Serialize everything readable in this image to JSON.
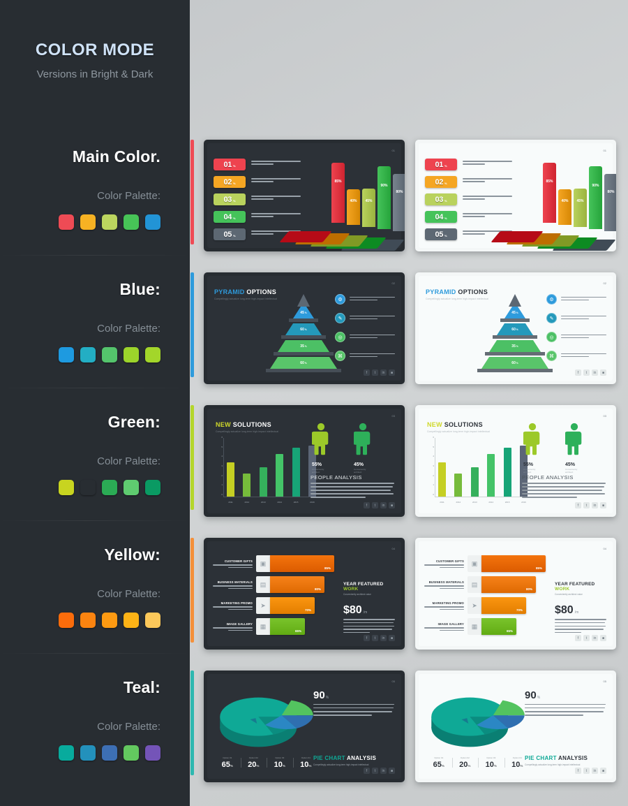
{
  "sidebar": {
    "title": "COLOR MODE",
    "subtitle": "Versions in Bright & Dark",
    "palette_label": "Color Palette:",
    "rows": [
      {
        "title": "Main Color.",
        "accent": "#ef4b55",
        "swatches": [
          "#ee4b55",
          "#f7b223",
          "#bcd55f",
          "#47c457",
          "#2294d6"
        ]
      },
      {
        "title": "Blue:",
        "accent": "#2e9bdc",
        "swatches": [
          "#1e9ae0",
          "#23aec4",
          "#54c46c",
          "#9cd42b",
          "#a3d62a"
        ]
      },
      {
        "title": "Green:",
        "accent": "#b4d62c",
        "swatches": [
          "#c8d420",
          "#6bb council",
          "#2bab55",
          "#5fcb70",
          "#0a9a63"
        ]
      },
      {
        "title": "Yellow:",
        "accent": "#f4903a",
        "swatches": [
          "#fb6c0b",
          "#fb8410",
          "#fd9a12",
          "#fdb316",
          "#fcc85a"
        ]
      },
      {
        "title": "Teal:",
        "accent": "#2eb8b0",
        "swatches": [
          "#08ab9d",
          "#2391bc",
          "#3d6fb4",
          "#63c85f",
          "#7454b8"
        ]
      }
    ]
  },
  "slides": [
    {
      "id": "bar-3d",
      "page": "01",
      "items": [
        {
          "num": "01",
          "pct": "85",
          "color": "#ee434f"
        },
        {
          "num": "02",
          "pct": "40",
          "color": "#f5a623"
        },
        {
          "num": "03",
          "pct": "45",
          "color": "#b9d25d"
        },
        {
          "num": "04",
          "pct": "90",
          "color": "#45c35a"
        },
        {
          "num": "05",
          "pct": "80",
          "color": "#5d6873"
        }
      ],
      "bars": [
        {
          "value": 85,
          "label": "85%",
          "color": "#ee434f"
        },
        {
          "value": 40,
          "label": "40%",
          "color": "#f5a623"
        },
        {
          "value": 45,
          "label": "45%",
          "color": "#b9d25d"
        },
        {
          "value": 90,
          "label": "90%",
          "color": "#45c35a"
        },
        {
          "value": 80,
          "label": "80%",
          "color": "#78838e"
        }
      ]
    },
    {
      "id": "pyramid",
      "page": "02",
      "title_a": "PYRAMID",
      "title_b": " OPTIONS",
      "subtitle": "Compellingly actualize long-term high-impact intellectual",
      "levels": [
        {
          "value": "45",
          "unit": "%",
          "color": "#2e9bdc"
        },
        {
          "value": "60",
          "unit": "%",
          "color": "#2499bb"
        },
        {
          "value": "35",
          "unit": "%",
          "color": "#4cc065"
        },
        {
          "value": "60",
          "unit": "%",
          "color": "#59c56a"
        }
      ],
      "legend_colors": [
        "#2e9bdc",
        "#2499bb",
        "#4cc065",
        "#59c56a"
      ],
      "legend_icons": [
        "⚙",
        "✎",
        "◎",
        "⌘"
      ],
      "socials": [
        "f",
        "t",
        "in",
        "■"
      ]
    },
    {
      "id": "columns",
      "page": "03",
      "title_a": "NEW",
      "title_b": " SOLUTIONS",
      "subtitle": "Compellingly actualize long-term high-impact intellectual",
      "analysis_title": "PEOPLE ANALYSIS",
      "people": [
        {
          "value": "55%",
          "caption": "Conveniently architect",
          "color": "#9cc929"
        },
        {
          "value": "45%",
          "caption": "Conveniently architect",
          "color": "#2eb05a"
        }
      ],
      "socials": [
        "f",
        "t",
        "in",
        "■"
      ],
      "chart_data": {
        "type": "bar",
        "title": "NEW SOLUTIONS",
        "categories": [
          "2011",
          "2012",
          "2013",
          "2014",
          "2015",
          "2016"
        ],
        "values": [
          42,
          28,
          36,
          52,
          60,
          62
        ],
        "colors": [
          "#c5cf23",
          "#76bb3b",
          "#35b05c",
          "#44c368",
          "#17a477",
          "#5c6677"
        ],
        "ylabel": "",
        "xlabel": "",
        "ylim": [
          0,
          70
        ],
        "yticks": [
          "0",
          "1",
          "2",
          "3",
          "4",
          "5",
          "6"
        ],
        "grid": false,
        "legend": "none"
      }
    },
    {
      "id": "hbars",
      "page": "04",
      "rows": [
        {
          "label": "CUSTOMER GIFTS",
          "value": "85%",
          "pct": 92,
          "color": "#f4740d",
          "icon": "▣"
        },
        {
          "label": "BUSINESS MATERIALS",
          "value": "80%",
          "pct": 78,
          "color": "#f7821a",
          "icon": "▤"
        },
        {
          "label": "MARKETING PROMO",
          "value": "70%",
          "pct": 64,
          "color": "#fb9610",
          "icon": "➤"
        },
        {
          "label": "IMAGE GALLERY",
          "value": "65%",
          "pct": 50,
          "color": "#7ac42c",
          "icon": "▦"
        }
      ],
      "year_a": "YEAR FEATURED",
      "year_b": " WORK",
      "year_sub": "Conveniently architect value",
      "price": "$80",
      "price_unit": "/m",
      "socials": [
        "f",
        "t",
        "in",
        "■"
      ],
      "chart_data": {
        "type": "bar",
        "title": "YEAR FEATURED WORK",
        "categories": [
          "CUSTOMER GIFTS",
          "BUSINESS MATERIALS",
          "MARKETING PROMO",
          "IMAGE GALLERY"
        ],
        "values": [
          85,
          80,
          70,
          65
        ],
        "colors": [
          "#f4740d",
          "#f7821a",
          "#fb9610",
          "#7ac42c"
        ],
        "xlabel": "",
        "ylabel": "",
        "ylim": [
          0,
          100
        ],
        "orientation": "horizontal",
        "grid": false,
        "legend": "none"
      }
    },
    {
      "id": "pie",
      "page": "05",
      "big_value": "90",
      "big_unit": "%",
      "title_a": "PIE CHART",
      "title_b": " ANALYSIS",
      "subtitle": "Compellingly actualize long-term high-impact intellectual",
      "socials": [
        "f",
        "t",
        "in",
        "■"
      ],
      "stats": [
        {
          "key": "Option 01",
          "value": "65",
          "unit": "%"
        },
        {
          "key": "Option 02",
          "value": "20",
          "unit": "%"
        },
        {
          "key": "Option 03",
          "value": "10",
          "unit": "%"
        },
        {
          "key": "Option 04",
          "value": "10",
          "unit": "%"
        }
      ],
      "chart_data": {
        "type": "pie",
        "title": "PIE CHART ANALYSIS",
        "categories": [
          "Option 01",
          "Option 02",
          "Option 03",
          "Option 04"
        ],
        "values": [
          65,
          20,
          10,
          10
        ],
        "colors": [
          "#0fa996",
          "#2f6fb0",
          "#53c35f",
          "#0fa996"
        ],
        "legend": "bottom"
      }
    }
  ]
}
